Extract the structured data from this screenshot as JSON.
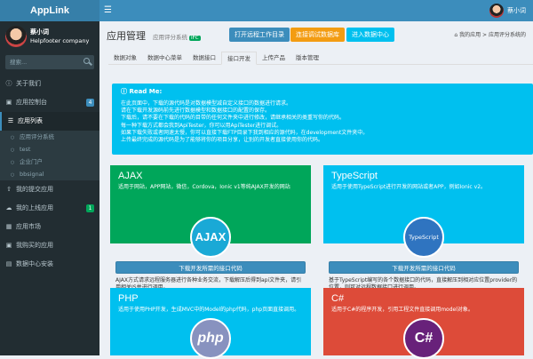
{
  "app": {
    "title": "AppLink",
    "menu_icon": "hamburger-icon"
  },
  "top_user": {
    "name": "蔡小词"
  },
  "sidebar": {
    "user": {
      "name": "蔡小词",
      "company": "Helpfooter company"
    },
    "search": {
      "placeholder": "搜索..."
    },
    "items": [
      {
        "label": "关于我们",
        "icon": "info-icon"
      },
      {
        "label": "应用控制台",
        "icon": "dashboard-icon",
        "badge": "4",
        "badge_color": "#3c8dbc"
      },
      {
        "label": "应用列表",
        "icon": "list-icon"
      },
      {
        "label": "我的提交应用",
        "icon": "upload-icon"
      },
      {
        "label": "我的上线应用",
        "icon": "cloud-icon",
        "badge": "1",
        "badge_color": "#00a65a"
      },
      {
        "label": "应用市场",
        "icon": "store-icon"
      },
      {
        "label": "我购买的应用",
        "icon": "cart-icon"
      },
      {
        "label": "数据中心安装",
        "icon": "server-icon"
      }
    ],
    "sub_items": [
      "应用评分系统",
      "test",
      "企业门户",
      "bbsignal"
    ]
  },
  "header": {
    "title": "应用管理",
    "subtitle": "应用评分系统",
    "version": "IFC",
    "buttons": [
      {
        "label": "打开远程工作目录",
        "color": "#3c8dbc"
      },
      {
        "label": "连接调试数据库",
        "color": "#f39c12"
      },
      {
        "label": "进入数据中心",
        "color": "#00c0ef"
      }
    ],
    "breadcrumb": {
      "home": "我的应用",
      "current": "应用评分系统的"
    }
  },
  "tabs": [
    "数据对象",
    "数据中心菜单",
    "数据接口",
    "接口开发",
    "上传产品",
    "版本管理"
  ],
  "active_tab": 3,
  "readme": {
    "title": "Read Me:",
    "lines": [
      "在此页面中，下载的源代码是对数据模型减自定义接口的数据进行请求。",
      "请在下载开发源码前先进行数据模型和数据接口的配置的保存。",
      "下载后，请不要在下载的代码的目带的任何文件夹中进行修改，请继承相关的类重写你的代码。",
      "每一种下载方式都会我到ApiTester，你可以用ApiTester进行调试。",
      "如果下载失败或者网速太慢，你可以直接下载FTP目录下我到相应的源代码，在development文件夹中。",
      "上传最终完成的源代码是为了能够将你的项目分享，让别的开发者直接使用你的代码。"
    ]
  },
  "cards": [
    {
      "name": "AJAX",
      "desc": "适用于网站，APP网站，微信，Cordova，Ionic v1等纯AJAX开发的网站",
      "logo_text": "AJAX",
      "color": "#00a65a",
      "logo_bg": "#1aa9d6",
      "download": "下载开发所需的接口代码",
      "text": "AJAX方式请求远程服务器进行各种业务交流，下载解压后得到api文件夹，请引用相关JS并进行调用。"
    },
    {
      "name": "TypeScript",
      "desc": "适用于使用TypeScript进行开发的网站或者APP，例如Ionic v2。",
      "logo_text": "TypeScript",
      "color": "#00c0ef",
      "logo_bg": "#2f74c0",
      "download": "下载开发所需的接口代码",
      "text": "基于TypeScript编写的各个数据接口的代码，直接解压到相对应位置provider的位置，则可对远程数据接口进行调用。"
    },
    {
      "name": "PHP",
      "desc": "适用于使用PHP开发，生成MVC中的Model的php代码，php页面直接调用。",
      "logo_text": "php",
      "color": "#00c0ef",
      "logo_bg": "#8892bf"
    },
    {
      "name": "C#",
      "desc": "适用于C#的程序开发，引用工程文件直接调用model对象。",
      "logo_text": "C#",
      "color": "#dd4b39",
      "logo_bg": "#68217a"
    }
  ]
}
